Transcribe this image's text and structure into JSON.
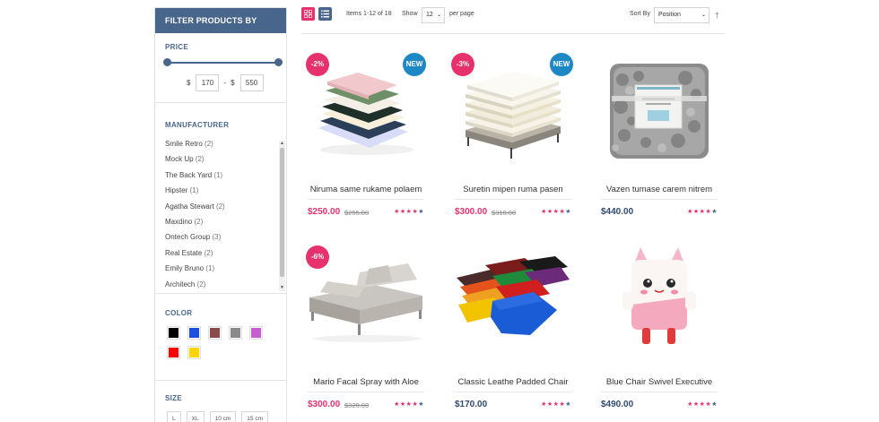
{
  "sidebar": {
    "title": "FILTER PRODUCTS BY",
    "price": {
      "title": "PRICE",
      "currency": "$",
      "min": "170",
      "max": "550",
      "separator": "-"
    },
    "manufacturer": {
      "title": "MANUFACTURER",
      "items": [
        {
          "name": "Smile Retro",
          "count": "(2)"
        },
        {
          "name": "Mock Up",
          "count": "(2)"
        },
        {
          "name": "The Back Yard",
          "count": "(1)"
        },
        {
          "name": "Hipster",
          "count": "(1)"
        },
        {
          "name": "Agatha Stewart",
          "count": "(2)"
        },
        {
          "name": "Maxdino",
          "count": "(2)"
        },
        {
          "name": "Ontech Group",
          "count": "(3)"
        },
        {
          "name": "Real Estate",
          "count": "(2)"
        },
        {
          "name": "Emily Bruno",
          "count": "(1)"
        },
        {
          "name": "Architech",
          "count": "(2)"
        }
      ]
    },
    "color": {
      "title": "COLOR",
      "swatches": [
        "#000000",
        "#1a4fe0",
        "#8e4a4a",
        "#8a8a8a",
        "#c65bd4",
        "#ff0000",
        "#ffd500"
      ]
    },
    "size": {
      "title": "SIZE",
      "options": [
        "L",
        "XL",
        "10 cm",
        "15 cm"
      ]
    }
  },
  "toolbar": {
    "items_label": "Items 1-12 of 18",
    "show_label": "Show",
    "show_value": "12",
    "per_page_label": "per page",
    "sort_label": "Sort By",
    "sort_value": "Position",
    "sort_dir_icon": "arrow-up-icon"
  },
  "products": [
    {
      "name": "Niruma same rukame polaem",
      "price": "$250.00",
      "old_price": "$255.00",
      "discount": "-2%",
      "new": "NEW",
      "rating": 4,
      "rating_max": 5
    },
    {
      "name": "Suretin mipen ruma pasen",
      "price": "$300.00",
      "old_price": "$310.00",
      "discount": "-3%",
      "new": "NEW",
      "rating": 4,
      "rating_max": 5
    },
    {
      "name": "Vazen tumase carem nitrem",
      "price": "$440.00",
      "old_price": "",
      "discount": "",
      "new": "",
      "rating": 4,
      "rating_max": 5
    },
    {
      "name": "Mario Facal Spray with Aloe",
      "price": "$300.00",
      "old_price": "$320.00",
      "discount": "-6%",
      "new": "",
      "rating": 4,
      "rating_max": 5
    },
    {
      "name": "Classic Leathe Padded Chair",
      "price": "$170.00",
      "old_price": "",
      "discount": "",
      "new": "",
      "rating": 4,
      "rating_max": 5
    },
    {
      "name": "Blue Chair Swivel Executive",
      "price": "$490.00",
      "old_price": "",
      "discount": "",
      "new": "",
      "rating": 4,
      "rating_max": 5
    }
  ],
  "colors": {
    "accent": "#e6316c",
    "brand": "#48658b",
    "new_badge": "#1e88c7"
  }
}
